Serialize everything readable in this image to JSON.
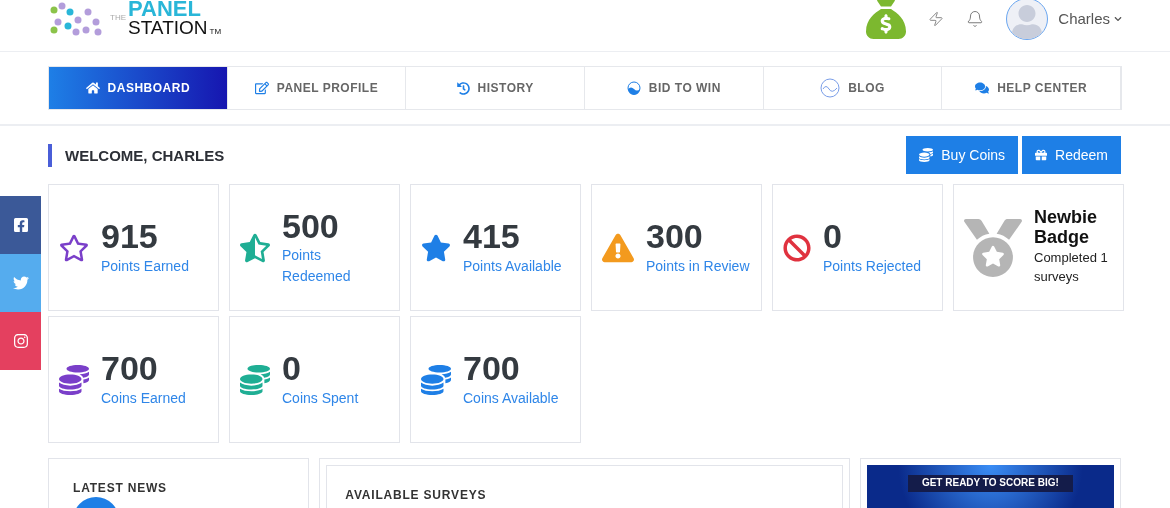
{
  "header": {
    "logo": {
      "small": "THE",
      "top": "PANEL",
      "bottom": "STATION",
      "mark": "TM"
    },
    "user": {
      "name": "Charles"
    }
  },
  "nav": {
    "tabs": [
      {
        "label": "DASHBOARD",
        "kind": "home",
        "selected": true
      },
      {
        "label": "PANEL PROFILE",
        "kind": "edit",
        "selected": false
      },
      {
        "label": "HISTORY",
        "kind": "history",
        "selected": false
      },
      {
        "label": "BID TO WIN",
        "kind": "bid",
        "selected": false
      },
      {
        "label": "BLOG",
        "kind": "blog",
        "selected": false
      },
      {
        "label": "HELP CENTER",
        "kind": "help",
        "selected": false
      }
    ]
  },
  "welcome": {
    "title": "WELCOME, CHARLES",
    "buttons": [
      {
        "label": "Buy Coins",
        "kind": "coins"
      },
      {
        "label": "Redeem",
        "kind": "gift"
      }
    ]
  },
  "cards": [
    {
      "kind": "star-outline",
      "color": "#7a3fc9",
      "value": "915",
      "label": "Points Earned"
    },
    {
      "kind": "star-half",
      "color": "#1fae94",
      "value": "500",
      "label": "Points Redeemed"
    },
    {
      "kind": "star",
      "color": "#1e7fe6",
      "value": "415",
      "label": "Points Available"
    },
    {
      "kind": "warning",
      "color": "#f39a1e",
      "value": "300",
      "label": "Points in Review"
    },
    {
      "kind": "ban",
      "color": "#e0323f",
      "value": "0",
      "label": "Points Rejected"
    },
    {
      "kind": "badge",
      "color": "#b5b5b5",
      "value": "Newbie Badge",
      "label": "Completed 1 surveys"
    },
    {
      "kind": "coins",
      "color": "#7a3fc9",
      "value": "700",
      "label": "Coins Earned"
    },
    {
      "kind": "coins",
      "color": "#1fae94",
      "value": "0",
      "label": "Coins Spent"
    },
    {
      "kind": "coins",
      "color": "#1e7fe6",
      "value": "700",
      "label": "Coins Available"
    }
  ],
  "social": [
    {
      "kind": "facebook",
      "color": "#3b5998"
    },
    {
      "kind": "twitter",
      "color": "#55acee"
    },
    {
      "kind": "instagram",
      "color": "#e4405f"
    }
  ],
  "panels": {
    "news": {
      "title": "LATEST NEWS"
    },
    "surveys": {
      "title": "AVAILABLE SURVEYS"
    },
    "banner": {
      "headline": "GET READY TO SCORE BIG!"
    }
  }
}
